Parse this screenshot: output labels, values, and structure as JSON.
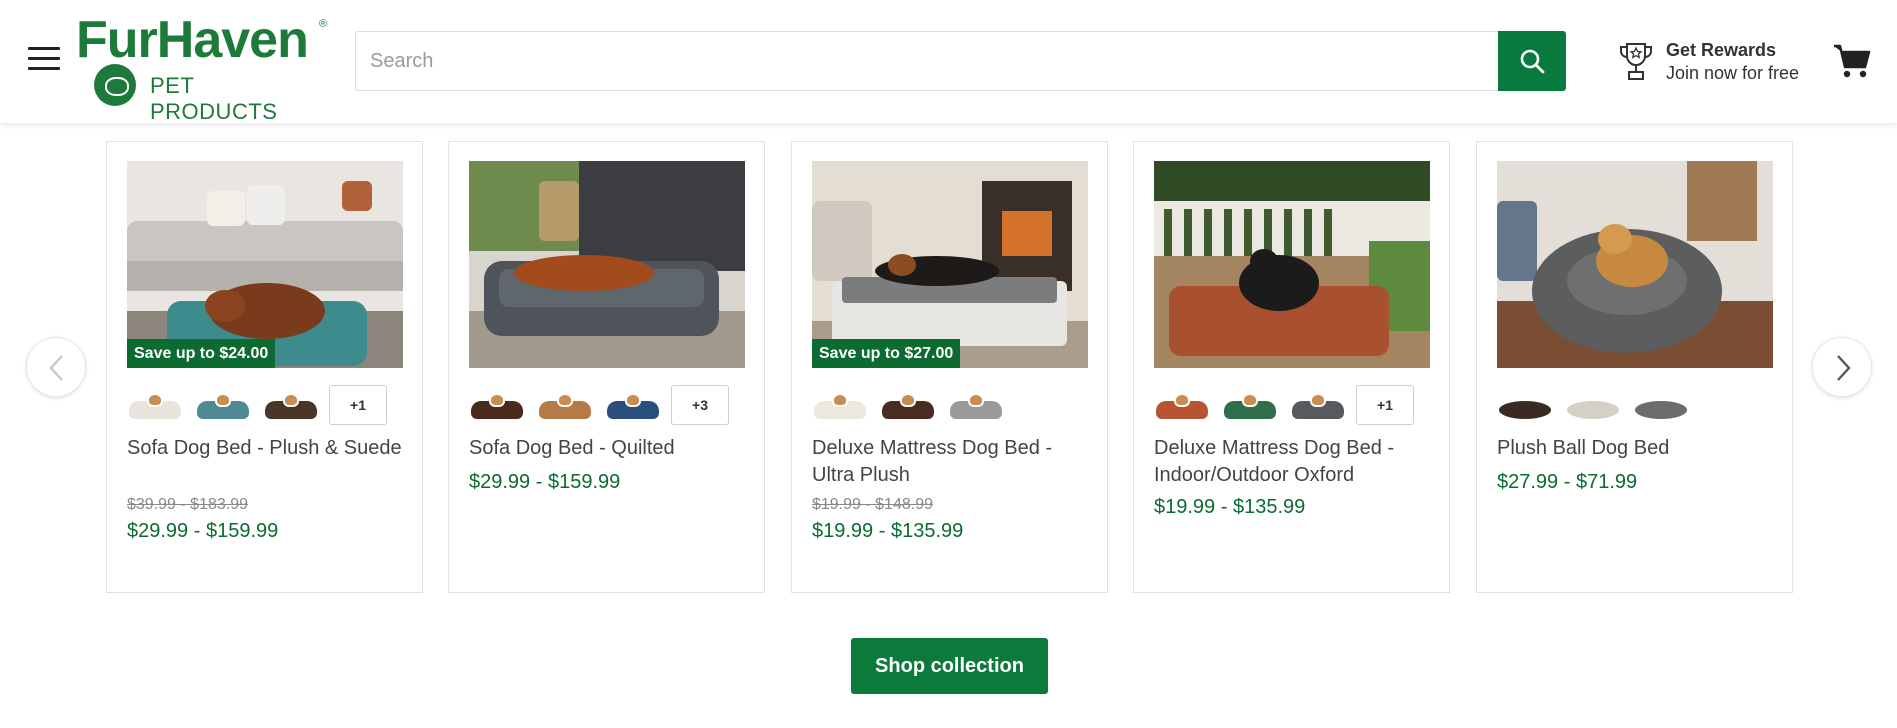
{
  "header": {
    "logo_main": "FurHaven",
    "logo_registered": "®",
    "logo_sub": "PET PRODUCTS",
    "search_placeholder": "Search",
    "rewards_title": "Get Rewards",
    "rewards_subtitle": "Join now for free"
  },
  "colors": {
    "brand_green": "#097a3e",
    "price_green": "#0b6b31",
    "badge_green": "#0b6b31"
  },
  "icons": {
    "menu": "hamburger-icon",
    "search": "search-icon",
    "rewards": "trophy-icon",
    "cart": "cart-icon",
    "prev": "chevron-left-icon",
    "next": "chevron-right-icon"
  },
  "products": [
    {
      "title": "Sofa Dog Bed - Plush & Suede",
      "badge": "Save up to $24.00",
      "swatches": [
        "#e8e4dc",
        "#4f8a94",
        "#4a3526"
      ],
      "more": "+1",
      "price_old": "$39.99 - $183.99",
      "price": "$29.99 - $159.99"
    },
    {
      "title": "Sofa Dog Bed - Quilted",
      "badge": "",
      "swatches": [
        "#4b2a1e",
        "#b57a46",
        "#2b4f7c"
      ],
      "more": "+3",
      "price_old": "",
      "price": "$29.99 - $159.99"
    },
    {
      "title": "Deluxe Mattress Dog Bed - Ultra Plush",
      "badge": "Save up to $27.00",
      "swatches": [
        "#ece8df",
        "#4a2d22",
        "#9a9a98"
      ],
      "more": "",
      "price_old": "$19.99 - $148.99",
      "price": "$19.99 - $135.99"
    },
    {
      "title": "Deluxe Mattress Dog Bed - Indoor/Outdoor Oxford",
      "badge": "",
      "swatches": [
        "#b85432",
        "#2f6e4a",
        "#545a60"
      ],
      "more": "+1",
      "price_old": "",
      "price": "$19.99 - $135.99"
    },
    {
      "title": "Plush Ball Dog Bed",
      "badge": "",
      "swatches": [
        "#3a2a24",
        "#d6cfc6",
        "#6a6c6e"
      ],
      "more": "",
      "price_old": "",
      "price": "$27.99 - $71.99"
    }
  ],
  "shop_button": "Shop collection"
}
